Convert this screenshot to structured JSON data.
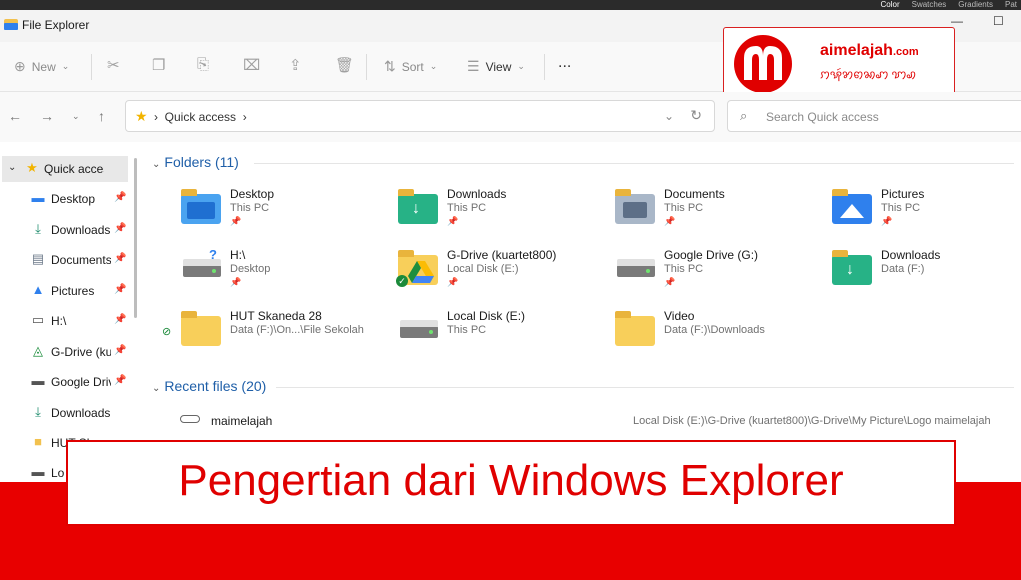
{
  "topstrip": {
    "tabs": [
      "Color",
      "Swatches",
      "Gradients",
      "Pat"
    ]
  },
  "window": {
    "title": "File Explorer"
  },
  "toolbar": {
    "new_label": "New",
    "sort_label": "Sort",
    "view_label": "View",
    "more_label": "..."
  },
  "address": {
    "crumb": "Quick access",
    "search_placeholder": "Search Quick access"
  },
  "logo": {
    "brand": "aimelajah",
    "domain": ".com",
    "tagline": "ꩀꩂꩃꩄꩅꩆꩇ ꩈꩉ",
    "color": "#e00000"
  },
  "sidebar": {
    "items": [
      {
        "label": "Quick access",
        "icon": "star-icon"
      },
      {
        "label": "Desktop",
        "icon": "desktop-icon"
      },
      {
        "label": "Downloads",
        "icon": "download-icon"
      },
      {
        "label": "Documents",
        "icon": "document-icon"
      },
      {
        "label": "Pictures",
        "icon": "picture-icon"
      },
      {
        "label": "H:\\",
        "icon": "drive-icon"
      },
      {
        "label": "G-Drive (kua",
        "icon": "google-drive-icon"
      },
      {
        "label": "Google Drive",
        "icon": "drive-icon"
      },
      {
        "label": "Downloads",
        "icon": "download-icon"
      },
      {
        "label": "HUT Skaneda",
        "icon": "folder-icon"
      },
      {
        "label": "Lo",
        "icon": "drive-icon"
      }
    ]
  },
  "folders": {
    "header": "Folders (11)",
    "items": [
      {
        "name": "Desktop",
        "sub": "This PC",
        "icon": "desktop-folder-icon",
        "pinned": true
      },
      {
        "name": "Downloads",
        "sub": "This PC",
        "icon": "downloads-folder-icon",
        "pinned": true
      },
      {
        "name": "Documents",
        "sub": "This PC",
        "icon": "documents-folder-icon",
        "pinned": true
      },
      {
        "name": "Pictures",
        "sub": "This PC",
        "icon": "pictures-folder-icon",
        "pinned": true
      },
      {
        "name": "H:\\",
        "sub": "Desktop",
        "icon": "drive-icon",
        "pinned": true
      },
      {
        "name": "G-Drive (kuartet800)",
        "sub": "Local Disk (E:)",
        "icon": "google-drive-icon",
        "pinned": true
      },
      {
        "name": "Google Drive (G:)",
        "sub": "This PC",
        "icon": "drive-icon",
        "pinned": true
      },
      {
        "name": "Downloads",
        "sub": "Data (F:)",
        "icon": "downloads-folder-icon",
        "pinned": false
      },
      {
        "name": "HUT Skaneda 28",
        "sub": "Data (F:)\\On...\\File Sekolah",
        "icon": "folder-icon",
        "pinned": false
      },
      {
        "name": "Local Disk (E:)",
        "sub": "This PC",
        "icon": "drive-icon",
        "pinned": false
      },
      {
        "name": "Video",
        "sub": "Data (F:)\\Downloads",
        "icon": "folder-icon",
        "pinned": false
      }
    ]
  },
  "recent": {
    "header": "Recent files (20)",
    "items": [
      {
        "name": "maimelajah",
        "location": "Local Disk (E:)\\G-Drive (kuartet800)\\G-Drive\\My Picture\\Logo maimelajah"
      }
    ]
  },
  "banner": {
    "text": "Pengertian dari Windows Explorer",
    "color": "#e00000"
  }
}
